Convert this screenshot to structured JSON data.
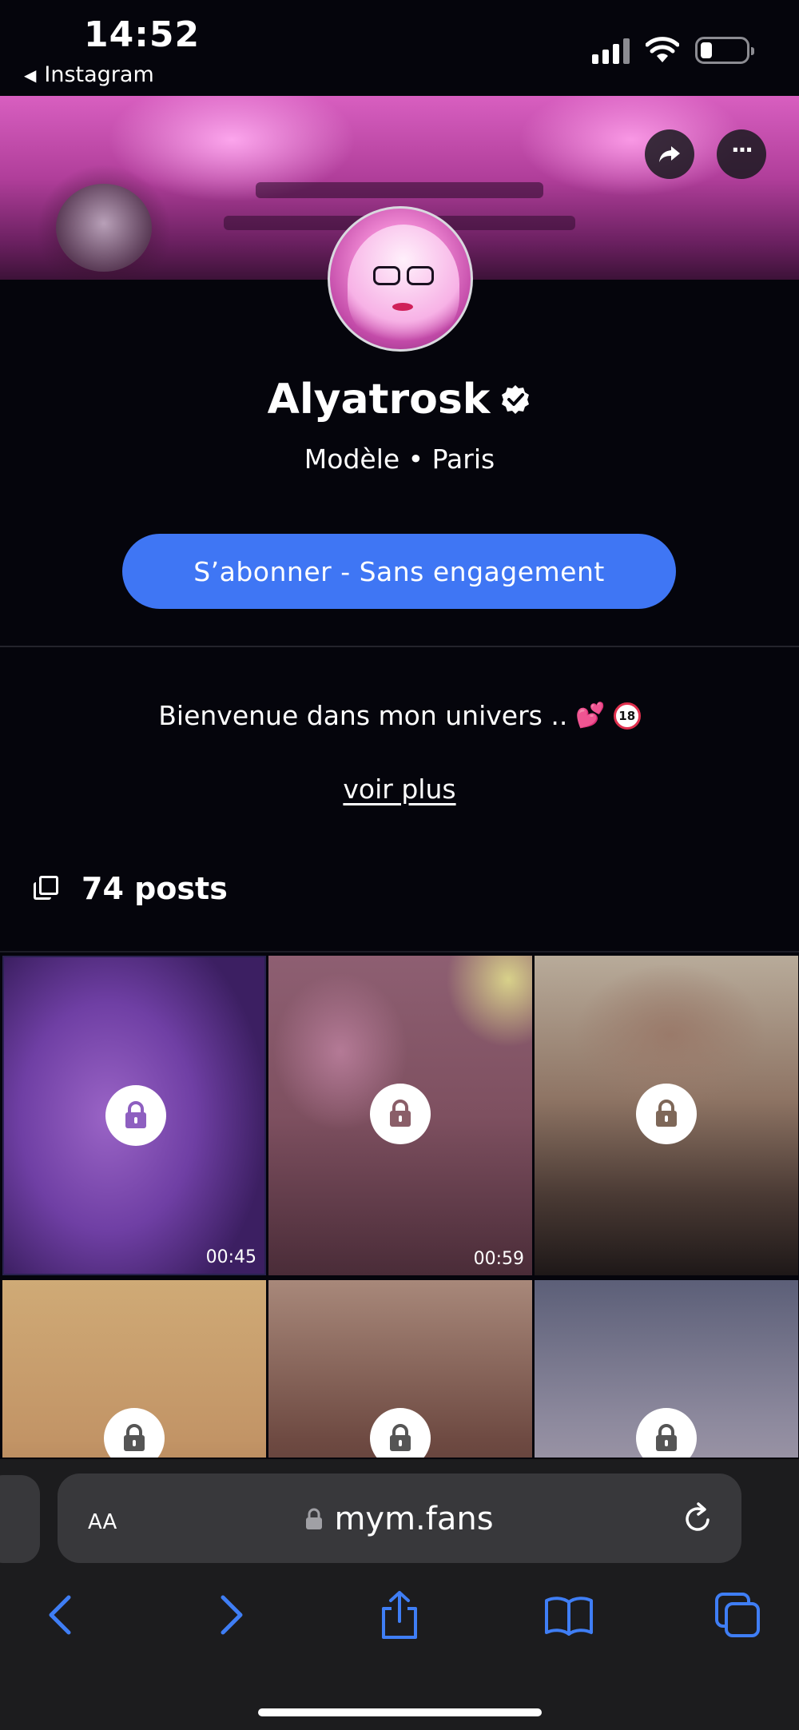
{
  "status_bar": {
    "time": "14:52",
    "back_label": "Instagram"
  },
  "profile": {
    "name": "Alyatrosk",
    "subtitle": "Modèle • Paris",
    "subscribe_label": "S’abonner - Sans engagement",
    "bio": "Bienvenue dans mon univers ..",
    "bio_emoji_heart": "💕",
    "bio_emoji_18": "18",
    "more_label": "voir plus",
    "posts_label": "74 posts"
  },
  "posts": [
    {
      "duration": "00:45"
    },
    {
      "duration": "00:59"
    },
    {
      "duration": ""
    },
    {
      "duration": ""
    },
    {
      "duration": ""
    },
    {
      "duration": ""
    }
  ],
  "browser": {
    "aa_label": "AA",
    "url": "mym.fans"
  },
  "colors": {
    "accent": "#3f76f4",
    "background": "#05050c",
    "lock_icon": "#8e5fc0",
    "browser_blue": "#3f7ef5"
  },
  "icons": [
    "share-icon",
    "more-icon",
    "verified-icon",
    "lock-icon",
    "posts-icon",
    "reload-icon",
    "back-icon",
    "forward-icon",
    "share-sheet-icon",
    "bookmarks-icon",
    "tabs-icon"
  ]
}
